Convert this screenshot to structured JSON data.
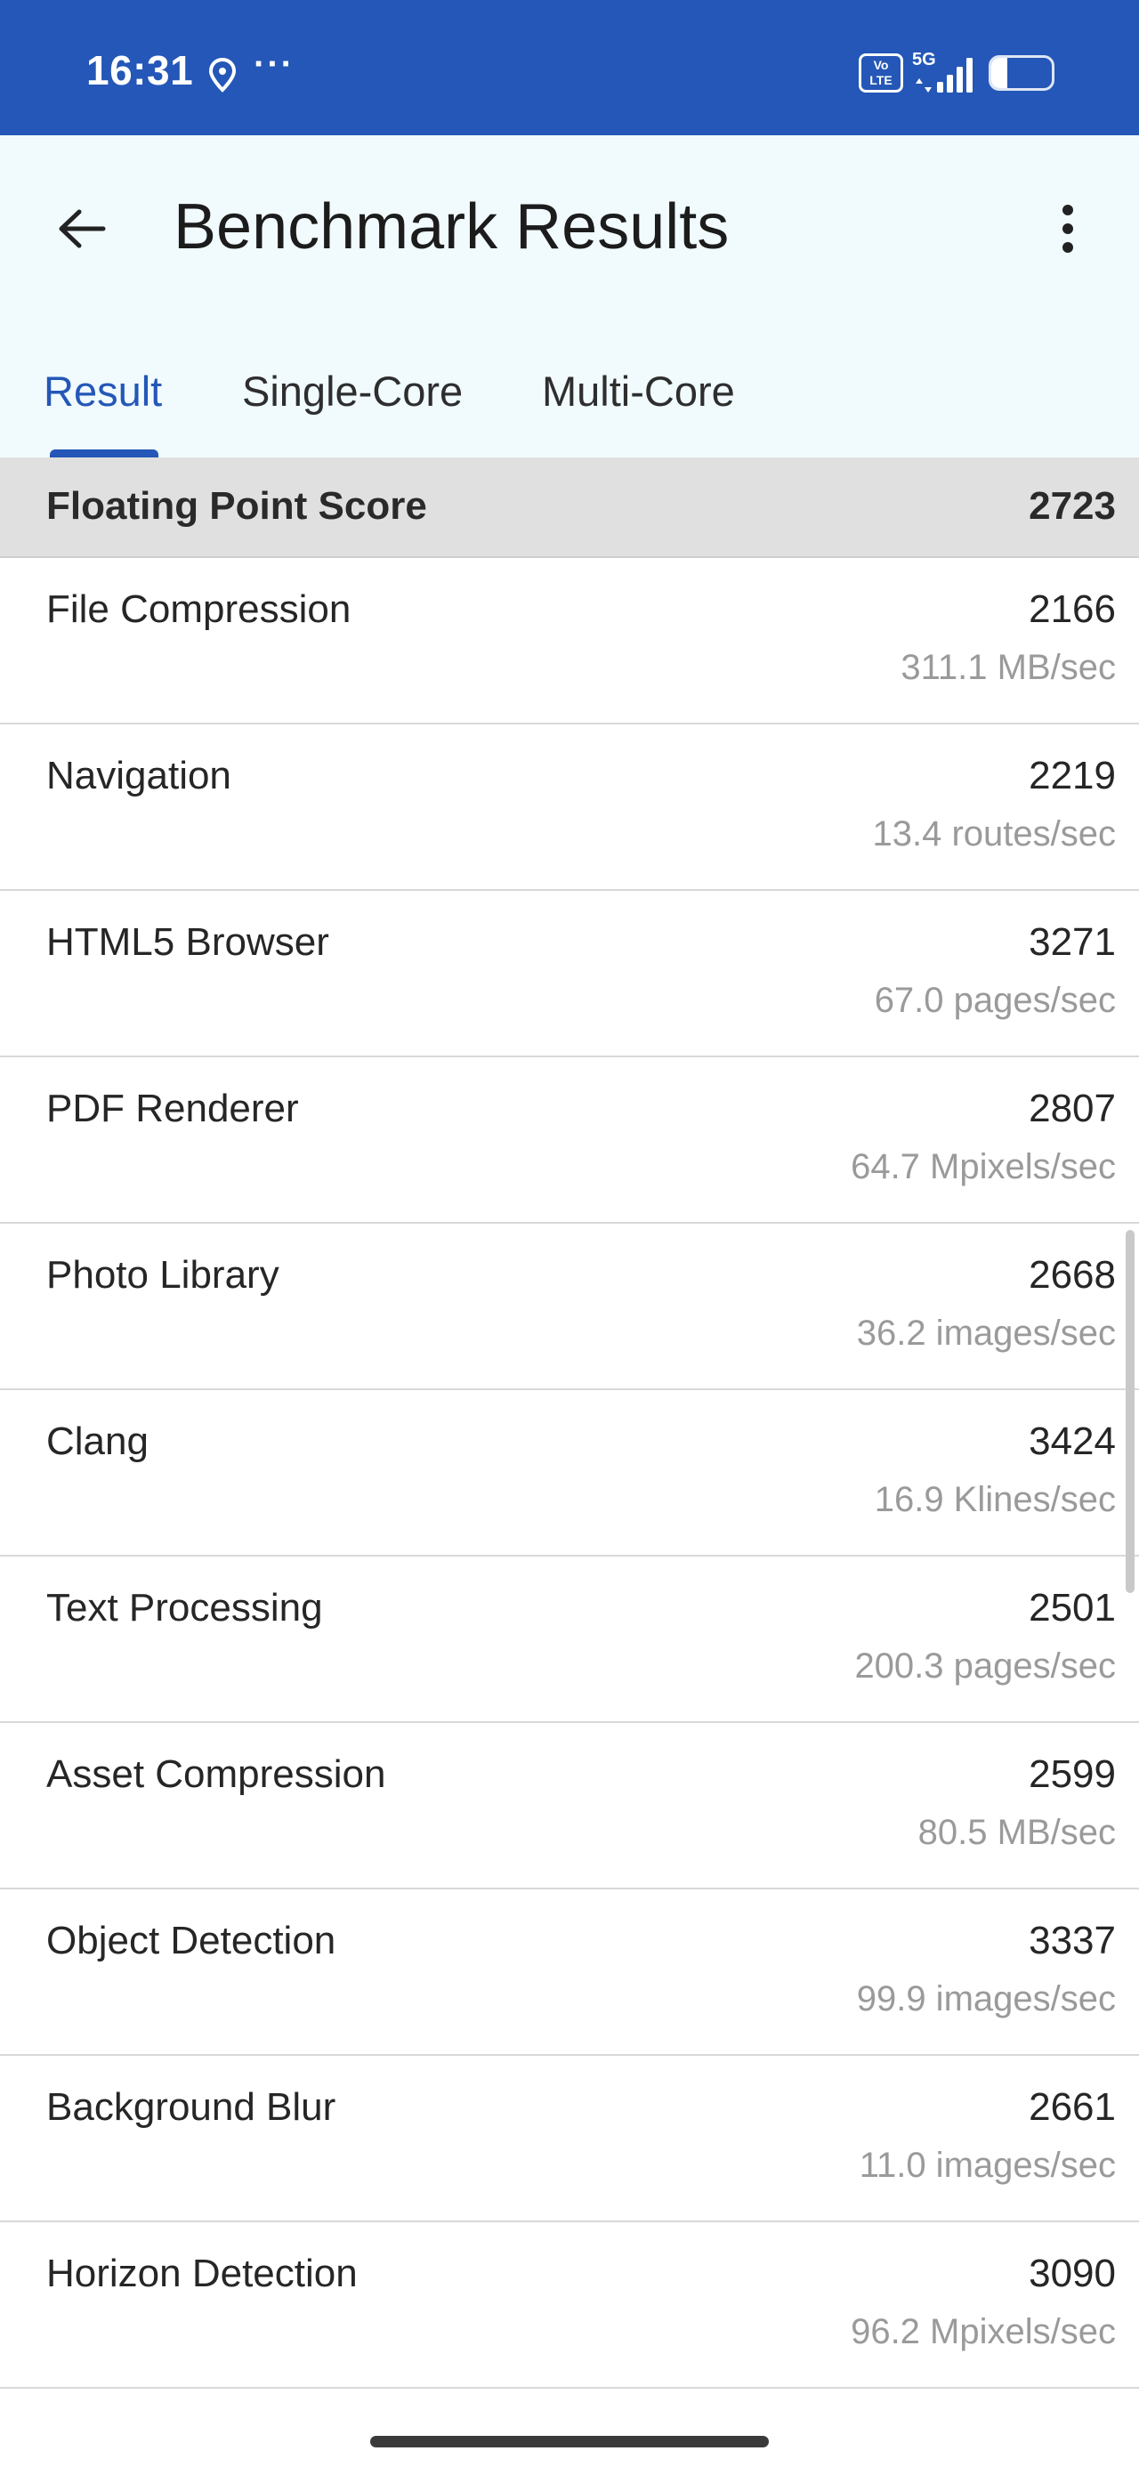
{
  "status_bar": {
    "time": "16:31",
    "more_indicator": "···",
    "volte_label_top": "Vo",
    "volte_label_bottom": "LTE",
    "network_label": "5G",
    "battery_level": "26"
  },
  "app_bar": {
    "title": "Benchmark Results"
  },
  "tabs": [
    {
      "label": "Result",
      "active": true
    },
    {
      "label": "Single-Core",
      "active": false
    },
    {
      "label": "Multi-Core",
      "active": false
    }
  ],
  "summary": {
    "label": "Floating Point Score",
    "value": "2723"
  },
  "results": [
    {
      "name": "File Compression",
      "score": "2166",
      "rate": "311.1 MB/sec"
    },
    {
      "name": "Navigation",
      "score": "2219",
      "rate": "13.4 routes/sec"
    },
    {
      "name": "HTML5 Browser",
      "score": "3271",
      "rate": "67.0 pages/sec"
    },
    {
      "name": "PDF Renderer",
      "score": "2807",
      "rate": "64.7 Mpixels/sec"
    },
    {
      "name": "Photo Library",
      "score": "2668",
      "rate": "36.2 images/sec"
    },
    {
      "name": "Clang",
      "score": "3424",
      "rate": "16.9 Klines/sec"
    },
    {
      "name": "Text Processing",
      "score": "2501",
      "rate": "200.3 pages/sec"
    },
    {
      "name": "Asset Compression",
      "score": "2599",
      "rate": "80.5 MB/sec"
    },
    {
      "name": "Object Detection",
      "score": "3337",
      "rate": "99.9 images/sec"
    },
    {
      "name": "Background Blur",
      "score": "2661",
      "rate": "11.0 images/sec"
    },
    {
      "name": "Horizon Detection",
      "score": "3090",
      "rate": "96.2 Mpixels/sec"
    }
  ],
  "colors": {
    "status_bar": "#2457b7",
    "accent": "#2457b7",
    "app_bar_bg": "#f1fbfe",
    "header_row_bg": "#e0e0e0"
  },
  "icons": {
    "back": "arrow-left-icon",
    "overflow": "more-vert-icon",
    "location": "location-pin-icon",
    "signal": "signal-bars-icon",
    "battery": "battery-icon"
  }
}
